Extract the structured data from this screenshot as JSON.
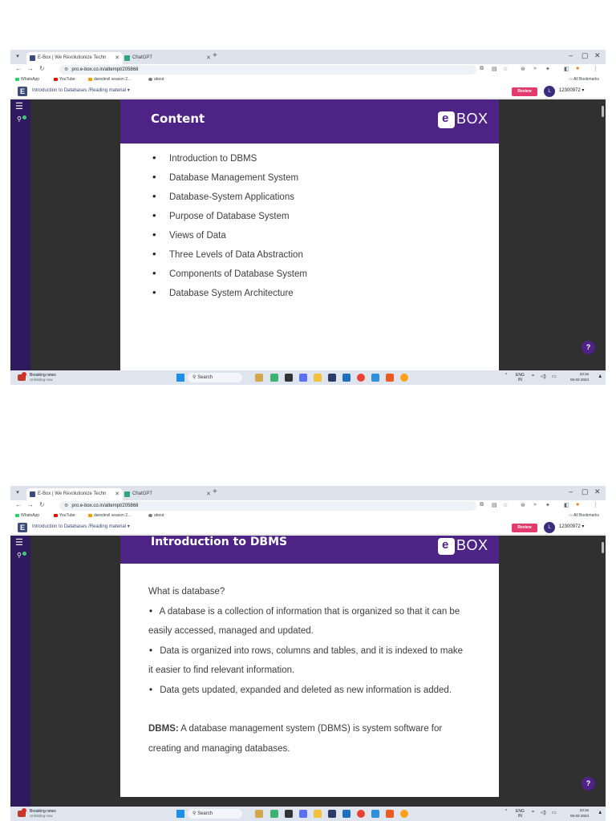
{
  "browser": {
    "tabs": [
      {
        "label": "E-Box | We Revolutionize Techn",
        "active": true
      },
      {
        "label": "ChatGPT",
        "active": false
      }
    ],
    "new_tab": "+",
    "window_controls": [
      "–",
      "▢",
      "✕"
    ],
    "url": "pro.e-box.co.in/attempt/205868",
    "bookmarks": [
      "WhatsApp",
      "YouTube",
      "daredevil season 2...",
      "about"
    ],
    "all_bookmarks": "All Bookmarks"
  },
  "site": {
    "logo_letter": "E",
    "breadcrumb": "Introduction to Databases /Reading material ▾",
    "review_label": "Review",
    "user_initial": "L",
    "user_id": "12300972 ▾"
  },
  "slide1": {
    "title": "Content",
    "logo_text": "BOX",
    "items": [
      "Introduction to DBMS",
      "Database Management System",
      "Database-System Applications",
      "Purpose of Database System",
      "Views of Data",
      "Three Levels of Data Abstraction",
      "Components of Database System",
      "Database System Architecture"
    ]
  },
  "slide2": {
    "title": "Introduction to DBMS",
    "logo_text": "BOX",
    "question": "What is database?",
    "bullets": [
      "A database is a collection of information that is organized so that it can be easily accessed, managed and updated.",
      "Data is organized into rows, columns and tables, and it is indexed to make it easier to find relevant information.",
      "Data gets updated, expanded and deleted as new information is added."
    ],
    "dbms_label": "DBMS:",
    "dbms_text": "A database management system (DBMS) is system software for creating and managing databases."
  },
  "help_label": "?",
  "taskbar": {
    "news_title": "Breaking news",
    "news_sub": "Unfolding now",
    "search_placeholder": "Search",
    "lang_top": "ENG",
    "lang_bottom": "IN",
    "time": "23:16",
    "date": "05-02-2024"
  },
  "colors": {
    "slide_header": "#4e2386",
    "sidebar": "#2f1a60",
    "review": "#e23b6d"
  }
}
